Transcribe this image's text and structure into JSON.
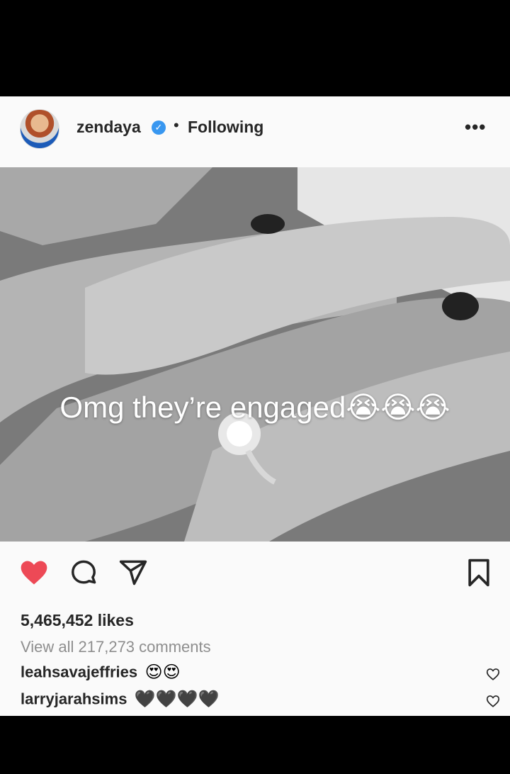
{
  "header": {
    "username": "zendaya",
    "separator": "•",
    "following_label": "Following",
    "more_label": "•••",
    "verified_mark": "✓"
  },
  "photo": {
    "overlay_text": "Omg they’re engaged😭😭😭"
  },
  "actions": {
    "like_icon": "heart-filled-icon",
    "comment_icon": "comment-icon",
    "share_icon": "send-icon",
    "save_icon": "bookmark-icon",
    "like_color": "#ed4956"
  },
  "stats": {
    "likes": "5,465,452 likes",
    "view_comments": "View all 217,273 comments"
  },
  "comments": [
    {
      "user": "leahsavajeffries",
      "text": "😍😍"
    },
    {
      "user": "larryjarahsims",
      "text": "🖤🖤🖤🖤"
    }
  ]
}
